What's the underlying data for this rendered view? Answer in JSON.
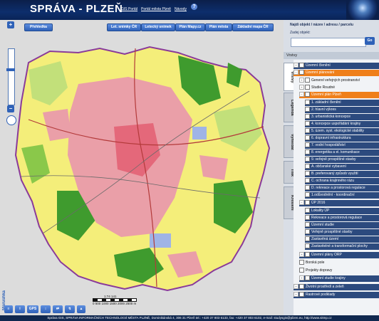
{
  "header": {
    "title": "SPRÁVA - PLZEŇ",
    "links": [
      "GIS Portál",
      "Portál města Plzně",
      "Návody"
    ],
    "help_label": "?"
  },
  "map": {
    "prehledka_label": "Přehledka",
    "basemap_buttons": [
      "Let. snímky ČR",
      "Letecký snímek",
      "Plán Mapy.cz",
      "Plán města",
      "Základní mapa ČR"
    ],
    "zoom_in": "+",
    "zoom_out": "−",
    "scale_label": "1:74 141",
    "scale_ticks": "0    500  1000 1500 2000 2500 m",
    "brand_label": "Marushka",
    "tool_gps": "GPS"
  },
  "panel": {
    "search_heading": "Najdi objekt / název / adresu / parcelu",
    "search_label": "Zadej objekt:",
    "search_value": "",
    "go_label": "Go",
    "layers_heading": "Vrstvy",
    "tabs": [
      "Vrstvy",
      "Legenda",
      "Vyhledat",
      "Tisk",
      "Kreslení"
    ],
    "tree": [
      {
        "label": "Územní členění"
      },
      {
        "label": "Územní plánování"
      },
      {
        "label": "Generel veřejných prostranství"
      },
      {
        "label": "Studie Roudné"
      },
      {
        "label": "Územní plán Plzeň"
      },
      {
        "label": "1. základní členění"
      },
      {
        "label": "2. hlavní výkres"
      },
      {
        "label": "3. urbanistická koncepce"
      },
      {
        "label": "4. koncepce uspořádání krajiny"
      },
      {
        "label": "5. územ. syst. ekologické stability"
      },
      {
        "label": "6. dopravní infrastruktura"
      },
      {
        "label": "7. vodní hospodářství"
      },
      {
        "label": "8. energetika a el. komunikace"
      },
      {
        "label": "9. veřejně prospěšné stavby"
      },
      {
        "label": "A. občanské vybavení"
      },
      {
        "label": "B. preferovaný způsob využití"
      },
      {
        "label": "C. ochrana krajinného rázu"
      },
      {
        "label": "D. rekreace a prostorová regulace"
      },
      {
        "label": "1.odůvodnění - koordinační"
      },
      {
        "label": "ÚP 2016"
      },
      {
        "label": "Lokality ÚP"
      },
      {
        "label": "Rekreace a prostorová regulace"
      },
      {
        "label": "Územní studie"
      },
      {
        "label": "Veřejně prospěšné stavby"
      },
      {
        "label": "Zastavěná území"
      },
      {
        "label": "Zastavitelné a transformační plochy"
      },
      {
        "label": "Územní plány ORP"
      },
      {
        "label": "Borská pole"
      },
      {
        "label": "Projekty dopravy"
      },
      {
        "label": "Územní studie krajiny"
      },
      {
        "label": "Životní prostředí a zeleň"
      },
      {
        "label": "Rastrové podklady"
      }
    ]
  },
  "footer": {
    "text": "Správa GIS, SPRÁVA INFORMAČNÍCH TECHNOLOGIÍ MĚSTA PLZNĚ, Dominikánská 4, 306 31 Plzeň tel.: +420 37 803 6133, fax: +420 37 803 6102, e-mail: studysgis@plzen.eu, http://www.sitmp.cz"
  },
  "colors": {
    "header_bg": "#0d2e6c",
    "accent_blue": "#2f62b8",
    "selected_orange": "#ef7f1a",
    "map_residential": "#ea9fa8",
    "map_green": "#3f9b2e",
    "map_yellow": "#f4ee7a"
  }
}
